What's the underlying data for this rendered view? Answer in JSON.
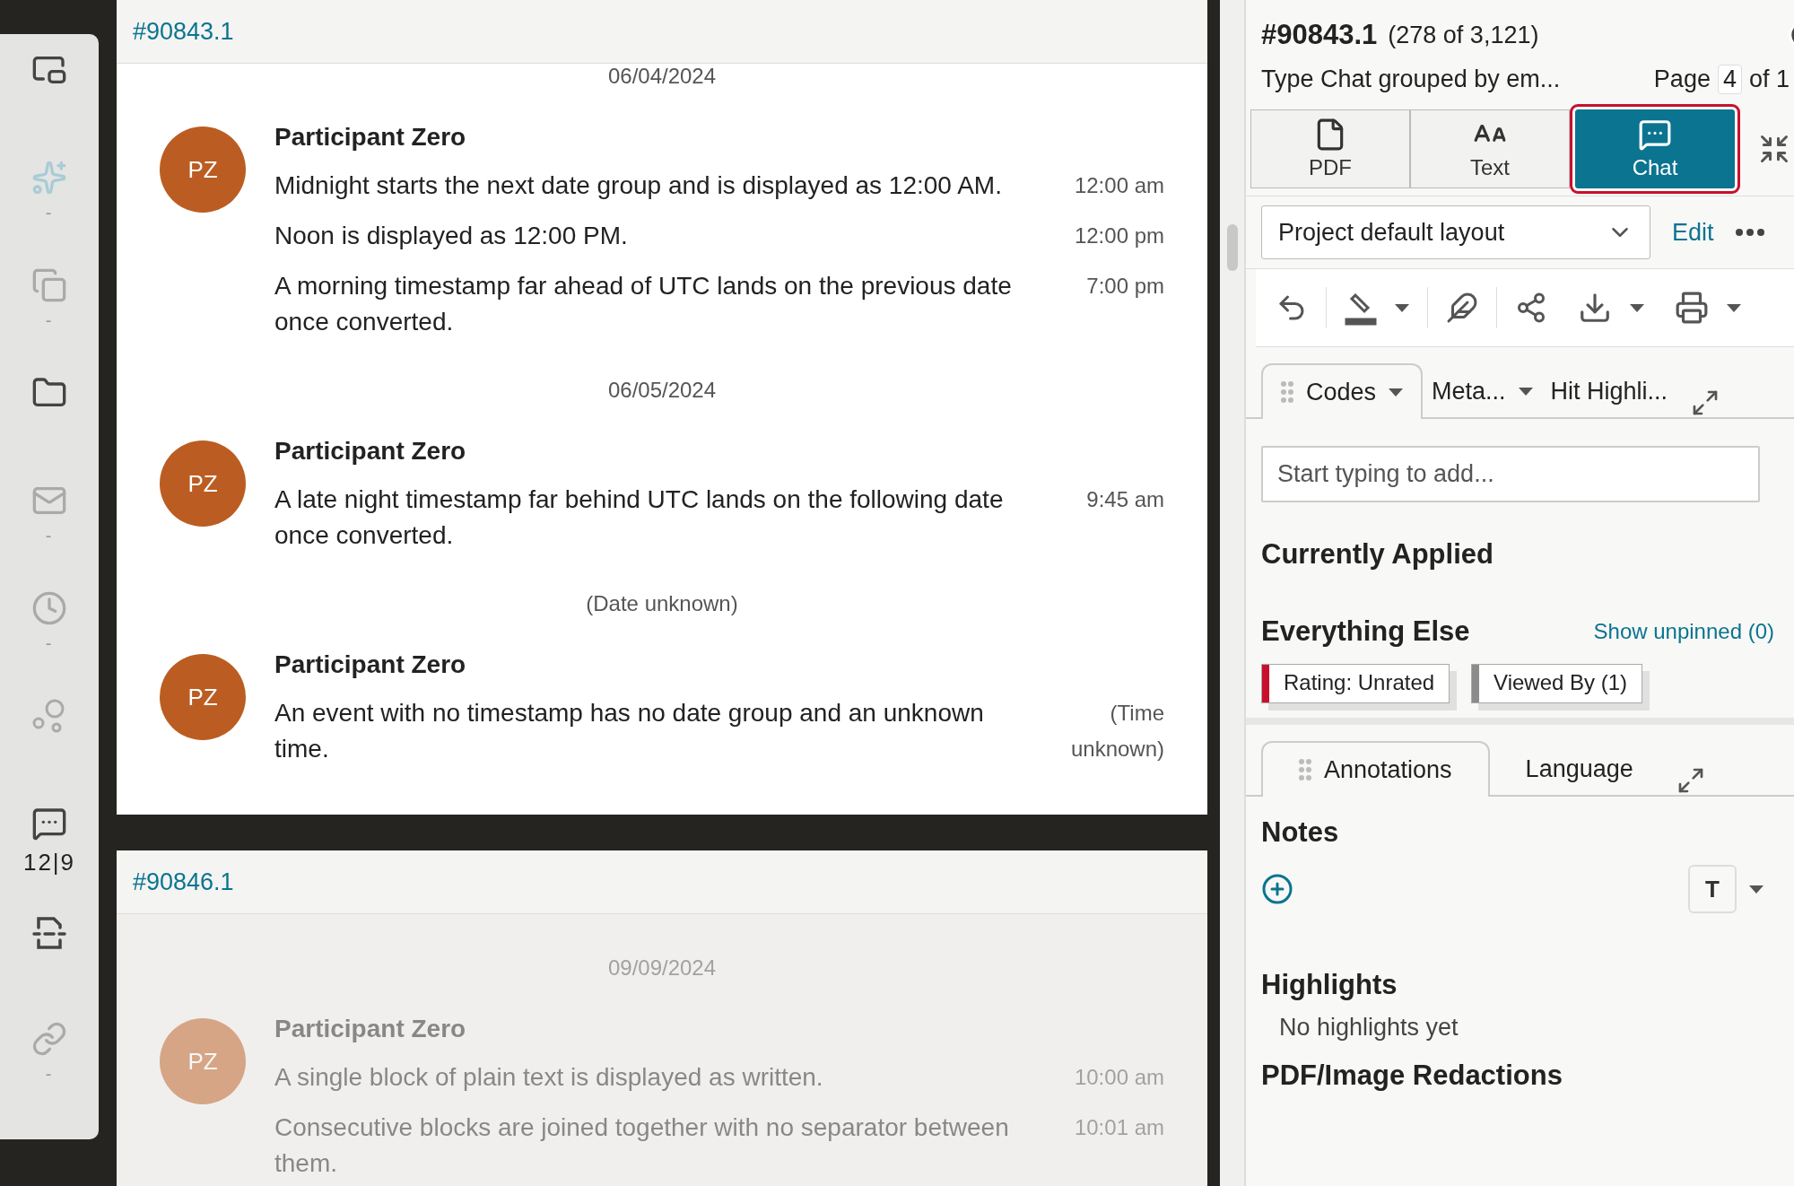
{
  "sidebar": {
    "items": [
      {
        "disabled": false
      },
      {
        "disabled": true,
        "count": "-"
      },
      {
        "disabled": true,
        "count": "-"
      },
      {
        "disabled": false
      },
      {
        "disabled": true,
        "count": "-"
      },
      {
        "disabled": true,
        "count": "-"
      },
      {
        "disabled": true
      },
      {
        "disabled": false,
        "count": "12|9"
      },
      {
        "disabled": false
      },
      {
        "disabled": true,
        "count": "-"
      }
    ]
  },
  "documents": [
    {
      "id": "#90843.1",
      "faded": false,
      "groups": [
        {
          "date": "06/04/2024",
          "messages": [
            {
              "initials": "PZ",
              "sender": "Participant Zero",
              "lines": [
                {
                  "text": "Midnight starts the next date group and is displayed as 12:00 AM.",
                  "time": "12:00 am"
                },
                {
                  "text": "Noon is displayed as 12:00 PM.",
                  "time": "12:00 pm"
                },
                {
                  "text": "A morning timestamp far ahead of UTC lands on the previous date once converted.",
                  "time": "7:00 pm"
                }
              ]
            }
          ]
        },
        {
          "date": "06/05/2024",
          "messages": [
            {
              "initials": "PZ",
              "sender": "Participant Zero",
              "lines": [
                {
                  "text": "A late night timestamp far behind UTC lands on the following date once converted.",
                  "time": "9:45 am"
                }
              ]
            }
          ]
        },
        {
          "date": "(Date unknown)",
          "messages": [
            {
              "initials": "PZ",
              "sender": "Participant Zero",
              "lines": [
                {
                  "text": "An event with no timestamp has no date group and an unknown time.",
                  "time": "(Time unknown)"
                }
              ]
            }
          ]
        }
      ]
    },
    {
      "id": "#90846.1",
      "faded": true,
      "groups": [
        {
          "date": "09/09/2024",
          "messages": [
            {
              "initials": "PZ",
              "sender": "Participant Zero",
              "lines": [
                {
                  "text": "A single block of plain text is displayed as written.",
                  "time": "10:00 am"
                },
                {
                  "text": "Consecutive blocks are joined together with no separator between them.",
                  "time": "10:01 am"
                }
              ]
            }
          ]
        }
      ]
    }
  ],
  "panel": {
    "doc_id": "#90843.1",
    "position": "(278 of 3,121)",
    "subtitle": "Type Chat grouped by em...",
    "page_label": "Page",
    "page": "4",
    "page_total": "of 1",
    "view_tabs": [
      {
        "label": "PDF",
        "selected": false
      },
      {
        "label": "Text",
        "selected": false
      },
      {
        "label": "Chat",
        "selected": true
      }
    ],
    "layout": {
      "value": "Project default layout"
    },
    "edit_link": "Edit",
    "code_tabs": [
      {
        "label": "Codes",
        "selected": true,
        "has_menu": true
      },
      {
        "label": "Meta...",
        "selected": false,
        "has_menu": true
      },
      {
        "label": "Hit Highli...",
        "selected": false,
        "has_menu": false
      }
    ],
    "code_input": {
      "placeholder": "Start typing to add..."
    },
    "currently_applied": "Currently Applied",
    "everything_else": "Everything Else",
    "show_unpinned": "Show unpinned (0)",
    "chips": [
      {
        "label": "Rating: Unrated",
        "color": "#c8102e"
      },
      {
        "label": "Viewed By (1)",
        "color": "#8c8c8a"
      }
    ],
    "annotation_tabs": [
      {
        "label": "Annotations",
        "selected": true
      },
      {
        "label": "Language",
        "selected": false
      }
    ],
    "notes_heading": "Notes",
    "format_button": "T",
    "highlights_heading": "Highlights",
    "highlights_empty": "No highlights yet",
    "redactions_heading": "PDF/Image Redactions"
  }
}
